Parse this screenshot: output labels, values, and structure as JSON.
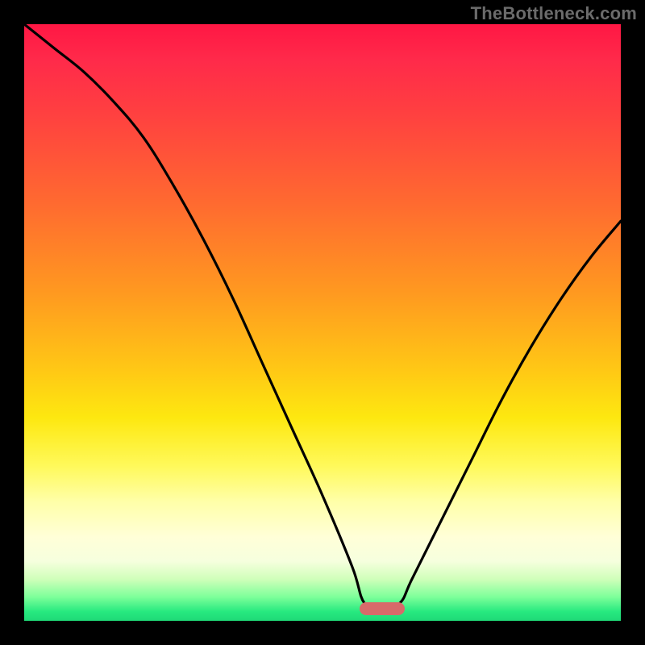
{
  "watermark": "TheBottleneck.com",
  "colors": {
    "frame": "#000000",
    "pill": "#d86a6a",
    "curve_stroke": "#000000",
    "gradient_top": "#ff1744",
    "gradient_bottom": "#1fd977"
  },
  "chart_data": {
    "type": "line",
    "title": "",
    "xlabel": "",
    "ylabel": "",
    "xlim": [
      0,
      100
    ],
    "ylim": [
      0,
      100
    ],
    "grid": false,
    "legend": false,
    "annotations": [
      {
        "kind": "pill",
        "x": 60,
        "y": 2,
        "color": "#d86a6a"
      }
    ],
    "series": [
      {
        "name": "bottleneck-curve",
        "x": [
          0,
          5,
          10,
          15,
          20,
          25,
          30,
          35,
          40,
          45,
          50,
          55,
          57,
          60,
          63,
          65,
          70,
          75,
          80,
          85,
          90,
          95,
          100
        ],
        "values": [
          100,
          96,
          92,
          87,
          81,
          73,
          64,
          54,
          43,
          32,
          21,
          9,
          3,
          2,
          3,
          7,
          17,
          27,
          37,
          46,
          54,
          61,
          67
        ]
      }
    ],
    "background_gradient_stops": [
      {
        "pos": 0.0,
        "color": "#ff1744"
      },
      {
        "pos": 0.06,
        "color": "#ff2a4a"
      },
      {
        "pos": 0.15,
        "color": "#ff4040"
      },
      {
        "pos": 0.3,
        "color": "#ff6a30"
      },
      {
        "pos": 0.45,
        "color": "#ff9920"
      },
      {
        "pos": 0.58,
        "color": "#ffc815"
      },
      {
        "pos": 0.66,
        "color": "#fde810"
      },
      {
        "pos": 0.74,
        "color": "#fff95a"
      },
      {
        "pos": 0.8,
        "color": "#ffffa8"
      },
      {
        "pos": 0.86,
        "color": "#ffffd8"
      },
      {
        "pos": 0.9,
        "color": "#f6ffde"
      },
      {
        "pos": 0.93,
        "color": "#d0ffba"
      },
      {
        "pos": 0.96,
        "color": "#7dff9a"
      },
      {
        "pos": 0.985,
        "color": "#26e97f"
      },
      {
        "pos": 1.0,
        "color": "#1fd977"
      }
    ]
  }
}
